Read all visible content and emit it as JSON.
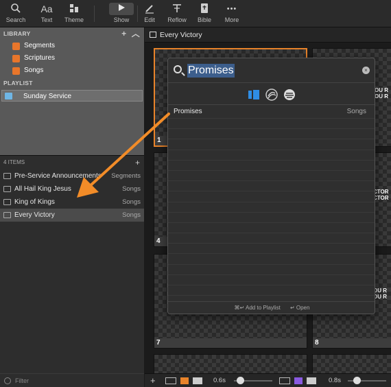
{
  "toolbar": {
    "buttons": [
      {
        "label": "Search",
        "icon": "search-icon"
      },
      {
        "label": "Text",
        "icon": "text-icon",
        "glyph": "Aa"
      },
      {
        "label": "Theme",
        "icon": "theme-icon"
      },
      {
        "label": "Show",
        "icon": "play-icon"
      },
      {
        "label": "Edit",
        "icon": "pencil-icon"
      },
      {
        "label": "Reflow",
        "icon": "reflow-icon"
      },
      {
        "label": "Bible",
        "icon": "bible-icon"
      },
      {
        "label": "More",
        "icon": "more-icon",
        "glyph": "•••"
      }
    ]
  },
  "library": {
    "header": "LIBRARY",
    "items": [
      "Segments",
      "Scriptures",
      "Songs"
    ]
  },
  "playlist": {
    "header": "PLAYLIST",
    "items": [
      "Sunday Service"
    ]
  },
  "items_list": {
    "header": "4 ITEMS",
    "rows": [
      {
        "name": "Pre-Service Announcements",
        "type": "Segments"
      },
      {
        "name": "All Hail King Jesus",
        "type": "Songs"
      },
      {
        "name": "King of Kings",
        "type": "Songs"
      },
      {
        "name": "Every Victory",
        "type": "Songs"
      }
    ]
  },
  "filter": {
    "placeholder": "Filter"
  },
  "main": {
    "title": "Every Victory",
    "slides": [
      {
        "num": "1"
      },
      {
        "num": "4"
      },
      {
        "num": "7"
      },
      {
        "num": "8"
      }
    ],
    "slide_text_a": "OU R\nOU R",
    "slide_text_b": "CTOR\nCTOR",
    "slide_text_c": "OU R\nOU R"
  },
  "bottom_bar": {
    "add": "+",
    "time1": "0.6s",
    "time2": "0.8s"
  },
  "popup": {
    "query": "Promises",
    "result": {
      "name": "Promises",
      "type": "Songs"
    },
    "footer_add": "⌘↵ Add to Playlist",
    "footer_open": "↵ Open"
  },
  "colors": {
    "accent": "#e8832a",
    "library_icon": "#e8762b",
    "playlist_icon": "#6fb6e5",
    "source_active": "#2f8de4"
  }
}
